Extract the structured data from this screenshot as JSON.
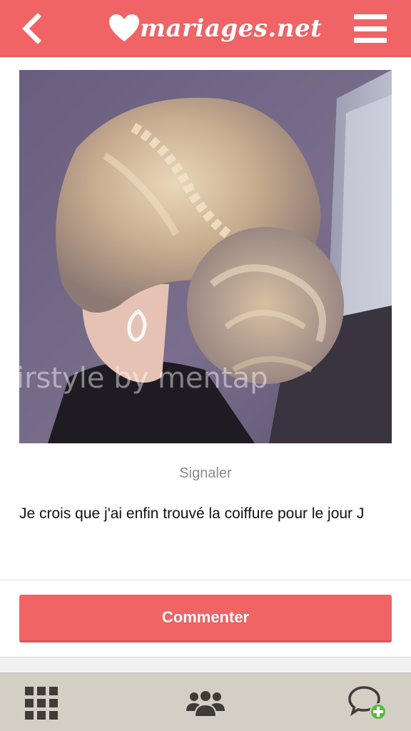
{
  "header": {
    "back_icon": "chevron-left-icon",
    "logo_text": "mariages.net",
    "logo_icon": "heart-icon",
    "menu_icon": "hamburger-menu-icon"
  },
  "post": {
    "image_watermark": "irstyle by mentap",
    "report_label": "Signaler",
    "text": "Je crois que j'ai enfin trouvé la coiffure pour le jour J"
  },
  "actions": {
    "comment_label": "Commenter"
  },
  "bottom_nav": {
    "items": [
      {
        "icon": "grid-icon"
      },
      {
        "icon": "community-group-icon"
      },
      {
        "icon": "new-chat-icon"
      }
    ]
  },
  "colors": {
    "brand": "#f06466",
    "nav_background": "#d3cfc4",
    "icon_dark": "#3f3c38",
    "add_badge": "#58b947"
  }
}
